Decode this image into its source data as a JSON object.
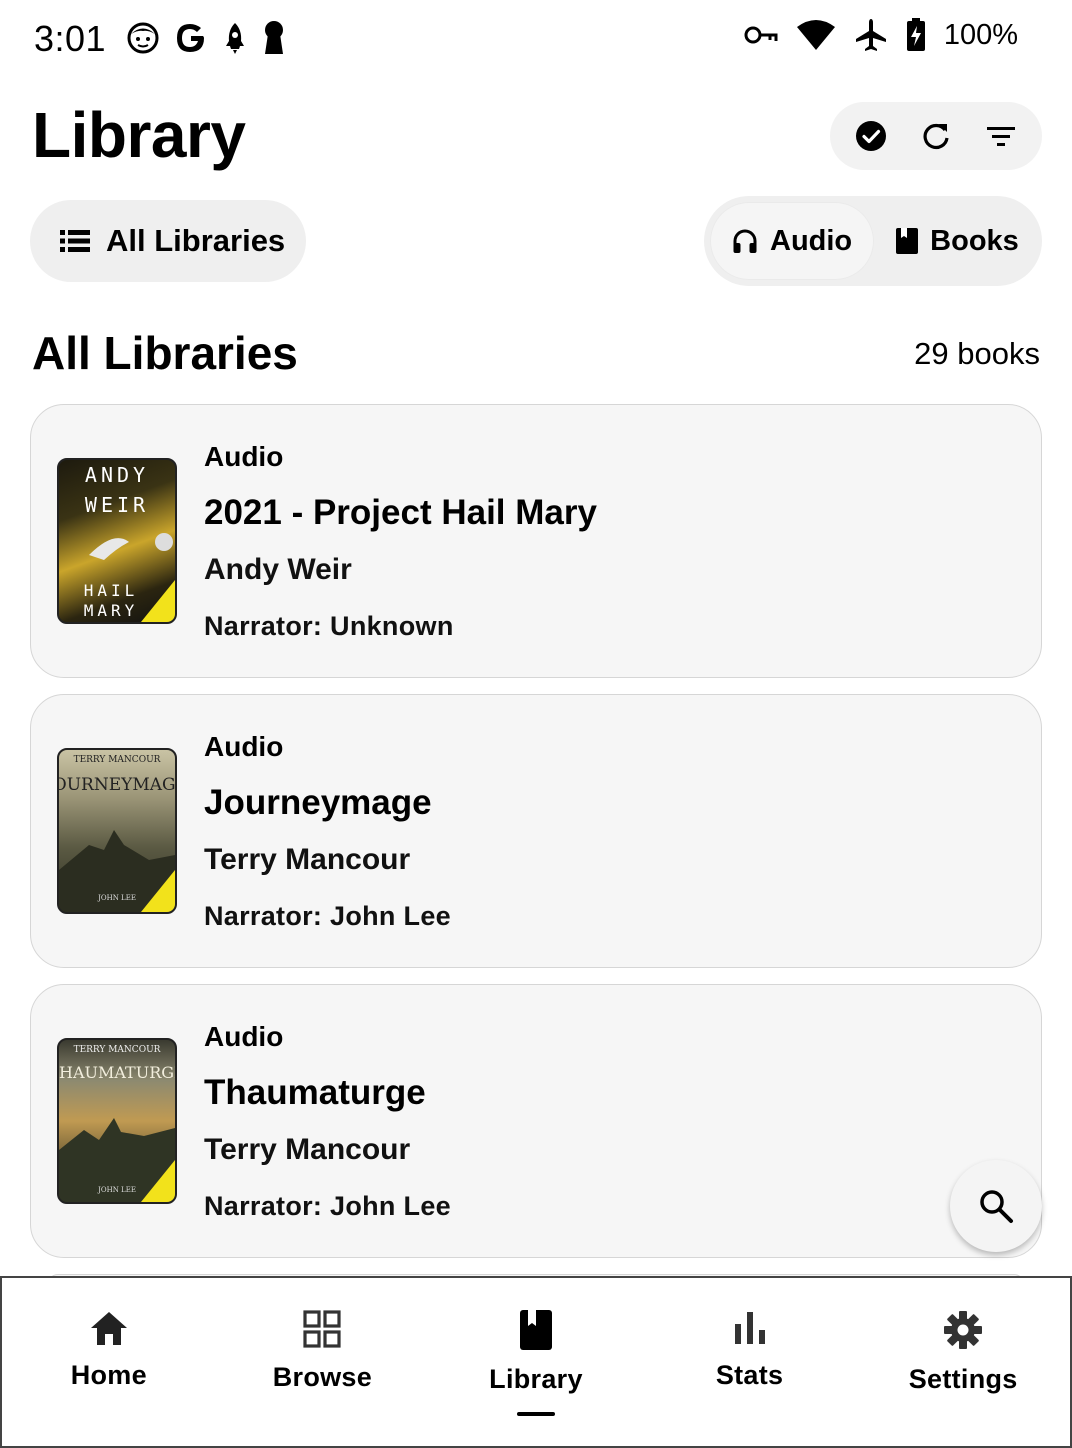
{
  "status_bar": {
    "time": "3:01",
    "battery": "100%",
    "left_icons": [
      "face-icon",
      "google-icon",
      "rocket-icon",
      "keyhole-icon"
    ],
    "right_icons": [
      "vpn-key-icon",
      "wifi-icon",
      "airplane-icon",
      "battery-charging-icon"
    ]
  },
  "header": {
    "title": "Library",
    "actions": [
      "select-all-icon",
      "refresh-icon",
      "filter-icon"
    ]
  },
  "library_selector": {
    "label": "All Libraries"
  },
  "media_toggle": {
    "options": [
      {
        "label": "Audio",
        "icon": "headphones-icon",
        "active": true
      },
      {
        "label": "Books",
        "icon": "book-icon",
        "active": false
      }
    ]
  },
  "section": {
    "title": "All Libraries",
    "count": "29 books"
  },
  "books": [
    {
      "type": "Audio",
      "title": "2021 - Project Hail Mary",
      "author": "Andy Weir",
      "narrator": "Narrator: Unknown",
      "cover": {
        "top": "ANDY",
        "mid": "WEIR",
        "bottom1": "HAIL",
        "bottom2": "MARY",
        "bg": "#c9a52a"
      }
    },
    {
      "type": "Audio",
      "title": "Journeymage",
      "author": "Terry Mancour",
      "narrator": "Narrator: John Lee",
      "cover": {
        "top": "TERRY MANCOUR",
        "mid": "JOURNEYMAGE",
        "bottom1": "JOHN LEE",
        "bg": "#6b6a55"
      }
    },
    {
      "type": "Audio",
      "title": "Thaumaturge",
      "author": "Terry Mancour",
      "narrator": "Narrator: John Lee",
      "cover": {
        "top": "TERRY MANCOUR",
        "mid": "THAUMATURGE",
        "bottom1": "JOHN LEE",
        "bg": "#7a6a48"
      }
    }
  ],
  "bottom_nav": [
    {
      "label": "Home",
      "icon": "home-icon",
      "active": false
    },
    {
      "label": "Browse",
      "icon": "grid-icon",
      "active": false
    },
    {
      "label": "Library",
      "icon": "book-icon",
      "active": true
    },
    {
      "label": "Stats",
      "icon": "bar-chart-icon",
      "active": false
    },
    {
      "label": "Settings",
      "icon": "gear-icon",
      "active": false
    }
  ],
  "colors": {
    "accent": "#000000",
    "surface": "#f6f6f6",
    "chip": "#efefef"
  }
}
